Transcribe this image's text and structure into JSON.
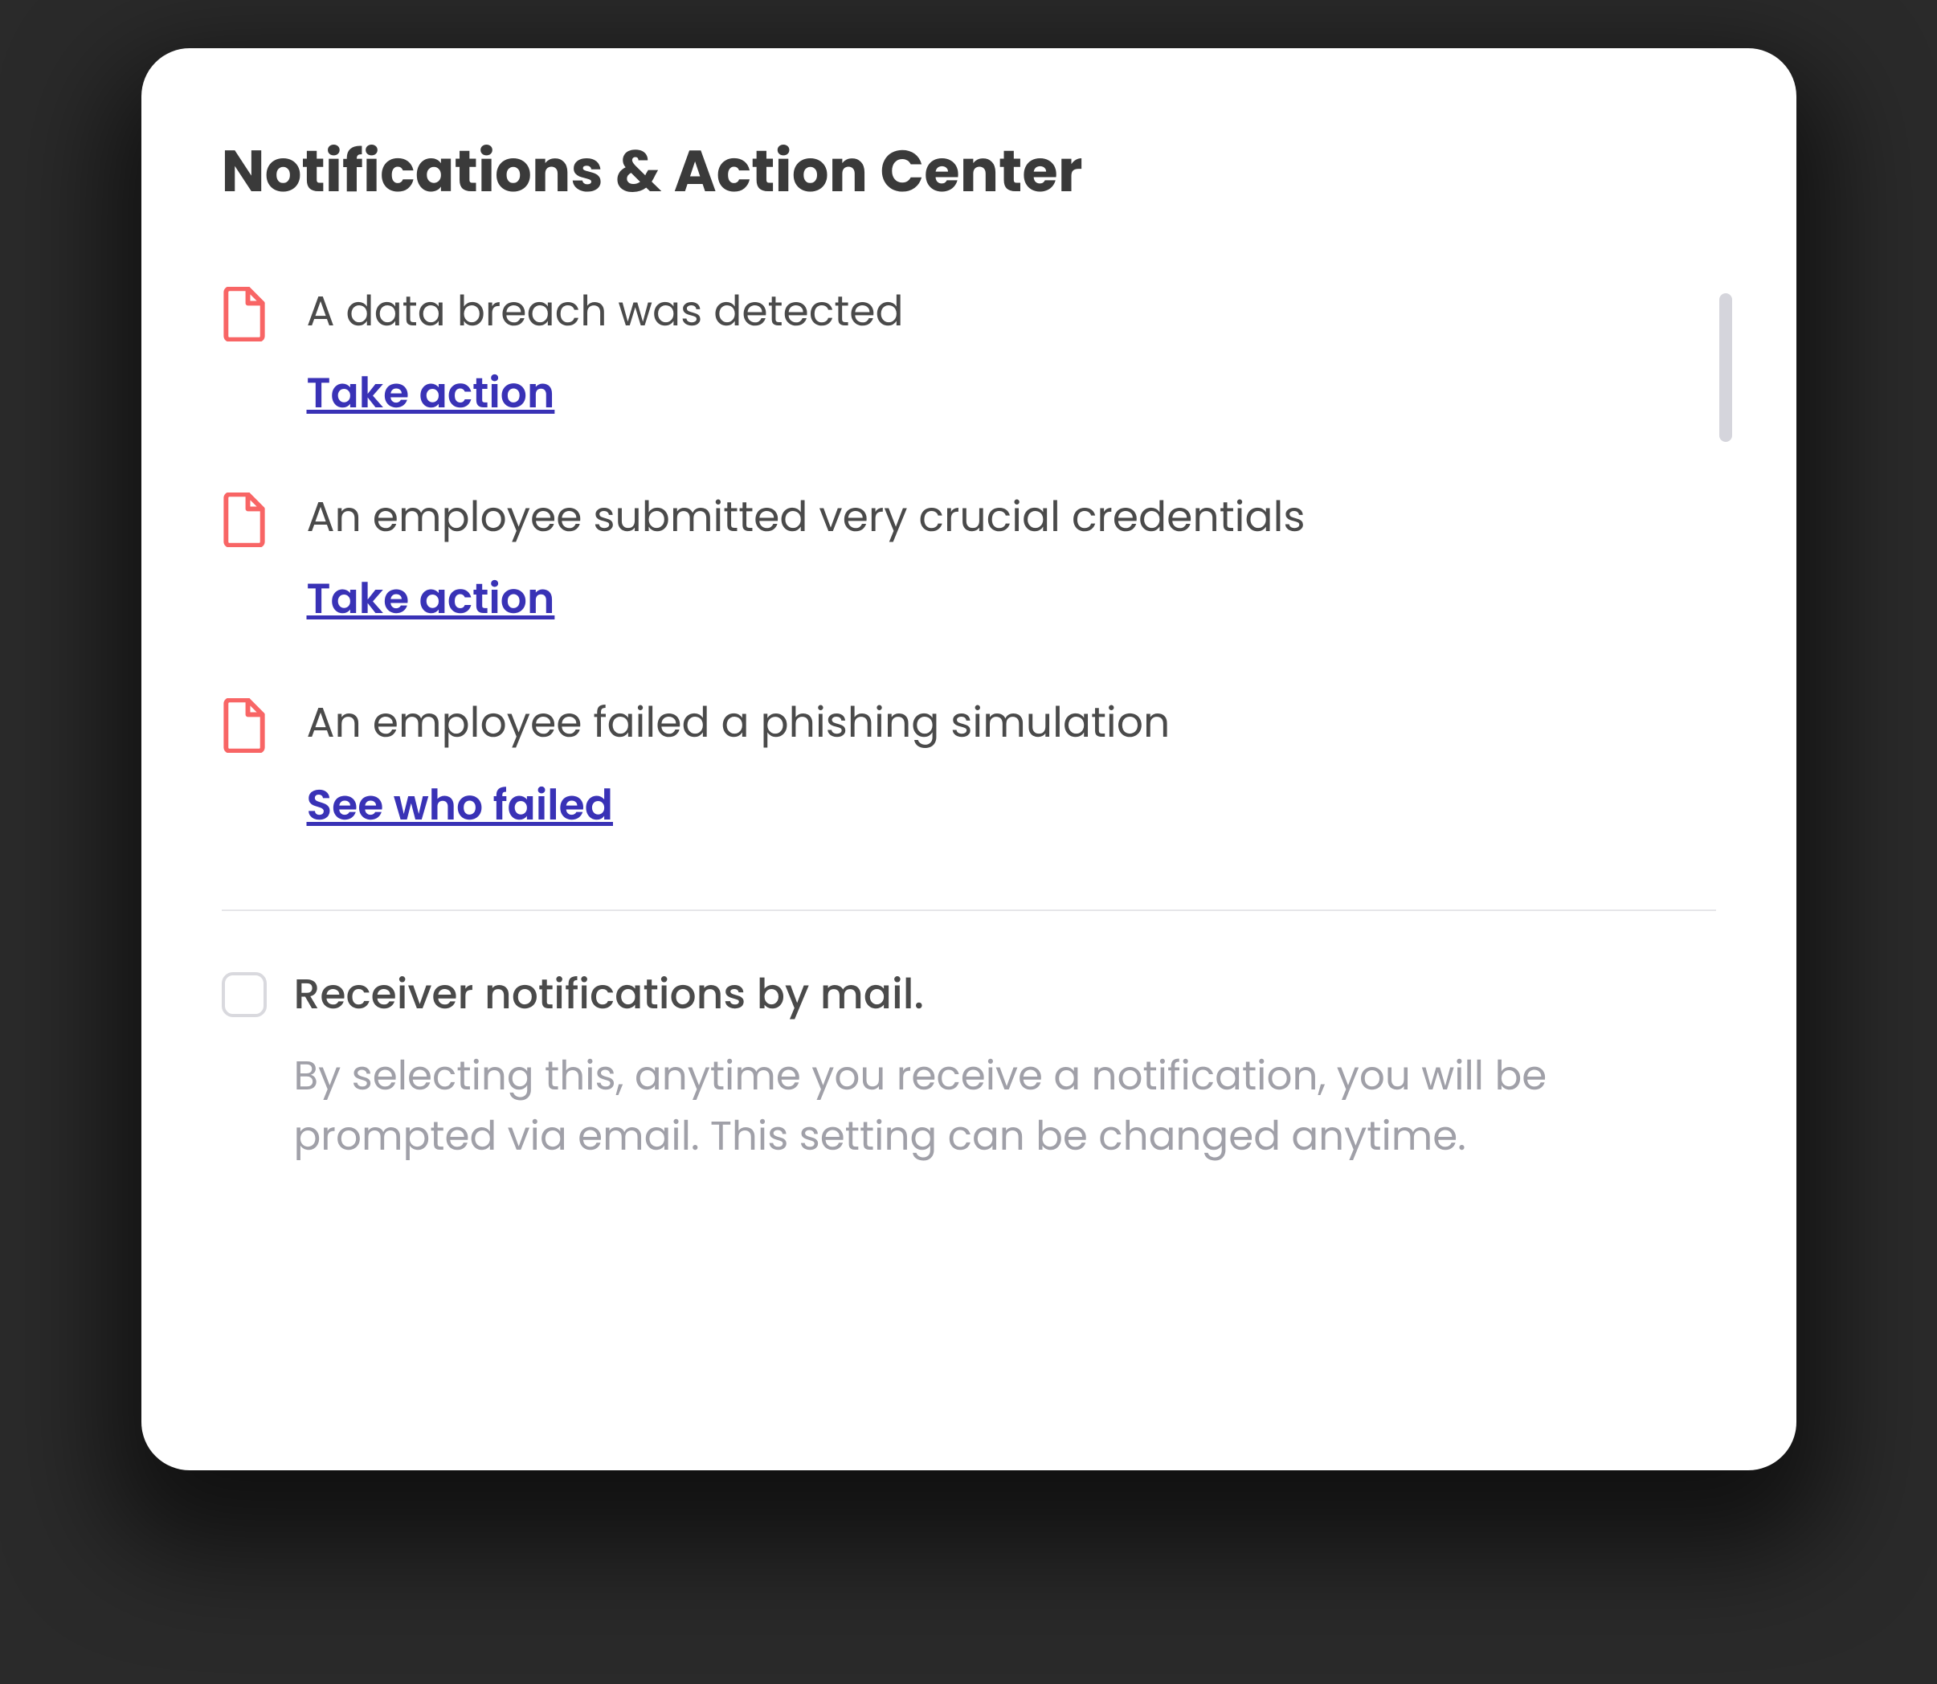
{
  "title": "Notifications & Action Center",
  "notifications": [
    {
      "text": "A data breach was detected",
      "action_label": "Take action"
    },
    {
      "text": "An employee submitted very crucial credentials",
      "action_label": "Take action"
    },
    {
      "text": "An employee failed a phishing simulation",
      "action_label": "See who failed"
    }
  ],
  "setting": {
    "label": "Receiver notifications by mail.",
    "description": "By selecting this, anytime you receive a notification, you will be prompted via email. This setting can be changed anytime.",
    "checked": false
  },
  "colors": {
    "icon": "#f86565",
    "link": "#3932b6",
    "title": "#3a3a3a",
    "body": "#4a4a4a",
    "muted": "#a0a0a8"
  }
}
